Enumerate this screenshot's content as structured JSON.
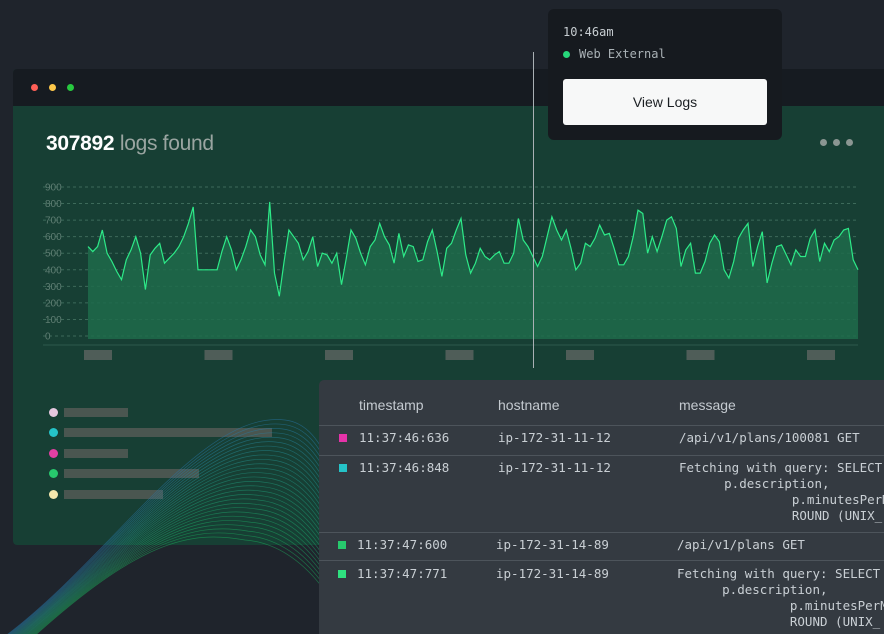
{
  "window": {
    "traffic_lights": [
      "#ff5f57",
      "#fec84a",
      "#27c93f"
    ],
    "count": "307892",
    "count_suffix": "logs found"
  },
  "chart_data": {
    "type": "area",
    "yticks": [
      "900",
      "800",
      "700",
      "600",
      "500",
      "400",
      "300",
      "200",
      "100",
      "0"
    ],
    "ylim": [
      0,
      900
    ],
    "grid": true,
    "values": [
      540,
      510,
      540,
      640,
      500,
      450,
      390,
      340,
      460,
      520,
      600,
      500,
      280,
      490,
      530,
      560,
      440,
      470,
      500,
      540,
      600,
      680,
      780,
      400,
      400,
      400,
      400,
      400,
      510,
      600,
      520,
      400,
      460,
      540,
      640,
      600,
      490,
      430,
      810,
      380,
      240,
      450,
      640,
      600,
      560,
      460,
      510,
      600,
      420,
      500,
      490,
      440,
      500,
      310,
      470,
      640,
      590,
      500,
      430,
      540,
      580,
      680,
      600,
      550,
      440,
      620,
      480,
      550,
      540,
      450,
      460,
      570,
      640,
      510,
      360,
      530,
      560,
      640,
      710,
      490,
      380,
      440,
      530,
      480,
      460,
      490,
      510,
      440,
      440,
      500,
      710,
      580,
      540,
      480,
      420,
      480,
      600,
      720,
      640,
      580,
      640,
      530,
      400,
      440,
      560,
      540,
      590,
      670,
      610,
      620,
      530,
      430,
      430,
      480,
      600,
      760,
      740,
      500,
      600,
      510,
      600,
      700,
      720,
      650,
      420,
      520,
      560,
      380,
      380,
      450,
      560,
      610,
      570,
      400,
      350,
      450,
      590,
      640,
      680,
      420,
      540,
      630,
      320,
      440,
      540,
      550,
      490,
      430,
      520,
      480,
      480,
      590,
      640,
      450,
      560,
      510,
      580,
      600,
      640,
      650,
      460,
      400
    ],
    "line_color": "#2dea88",
    "fill_color": "#1f6b4b"
  },
  "legend": {
    "colors": [
      "#e6c8df",
      "#25c3c8",
      "#e33fa3",
      "#27c96d",
      "#f4e7ad"
    ]
  },
  "tooltip": {
    "time": "10:46am",
    "source": "Web External",
    "button": "View Logs"
  },
  "table": {
    "headers": [
      "timestamp",
      "hostname",
      "message"
    ],
    "rows": [
      {
        "color": "#e633a9",
        "timestamp": "11:37:46:636",
        "hostname": "ip-172-31-11-12",
        "message": [
          "/api/v1/plans/100081 GET"
        ]
      },
      {
        "color": "#25c3c8",
        "timestamp": "11:37:46:848",
        "hostname": "ip-172-31-11-12",
        "message": [
          "Fetching with query: SELECT",
          "      p.description,",
          "               p.minutesPerMo",
          "               ROUND (UNIX_"
        ]
      },
      {
        "color": "#27c96d",
        "timestamp": "11:37:47:600",
        "hostname": "ip-172-31-14-89",
        "message": [
          "/api/v1/plans GET"
        ]
      },
      {
        "color": "#2fe07f",
        "timestamp": "11:37:47:771",
        "hostname": "ip-172-31-14-89",
        "message": [
          "Fetching with query: SELECT",
          "      p.description,",
          "               p.minutesPerMo",
          "               ROUND (UNIX_"
        ]
      }
    ]
  }
}
